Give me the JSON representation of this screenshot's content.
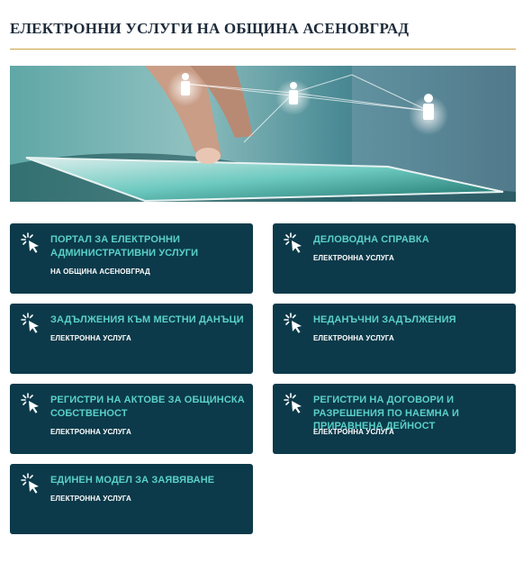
{
  "header": {
    "title": "ЕЛЕКТРОННИ УСЛУГИ НА ОБЩИНА АСЕНОВГРАД"
  },
  "banner": {
    "icon": "tablet-network-photo"
  },
  "colors": {
    "card_bg": "#0c3a4a",
    "card_title": "#5ad0c6",
    "card_sub": "#ffffff",
    "header_rule": "#c9a54a",
    "title_text": "#1d2b3a"
  },
  "services": [
    {
      "title": "ПОРТАЛ ЗА ЕЛЕКТРОННИ АДМИНИСТРАТИВНИ УСЛУГИ",
      "subtitle": "НА ОБЩИНА АСЕНОВГРАД",
      "icon": "cursor-click-icon"
    },
    {
      "title": "ДЕЛОВОДНА СПРАВКА",
      "subtitle": "ЕЛЕКТРОННА УСЛУГА",
      "icon": "cursor-click-icon"
    },
    {
      "title": "ЗАДЪЛЖЕНИЯ КЪМ МЕСТНИ ДАНЪЦИ",
      "subtitle": "ЕЛЕКТРОННА УСЛУГА",
      "icon": "cursor-click-icon"
    },
    {
      "title": "НЕДАНЪЧНИ ЗАДЪЛЖЕНИЯ",
      "subtitle": "ЕЛЕКТРОННА УСЛУГА",
      "icon": "cursor-click-icon"
    },
    {
      "title": "РЕГИСТРИ НА АКТОВЕ ЗА ОБЩИНСКА СОБСТВЕНОСТ",
      "subtitle": "ЕЛЕКТРОННА УСЛУГА",
      "icon": "cursor-click-icon"
    },
    {
      "title": "РЕГИСТРИ НА ДОГОВОРИ И РАЗРЕШЕНИЯ ПО НАЕМНА И ПРИРАВНЕНА ДЕЙНОСТ",
      "subtitle": "ЕЛЕКТРОННА УСЛУГА",
      "icon": "cursor-click-icon"
    },
    {
      "title": "ЕДИНЕН МОДЕЛ ЗА ЗАЯВЯВАНЕ",
      "subtitle": "ЕЛЕКТРОННА УСЛУГА",
      "icon": "cursor-click-icon"
    }
  ]
}
